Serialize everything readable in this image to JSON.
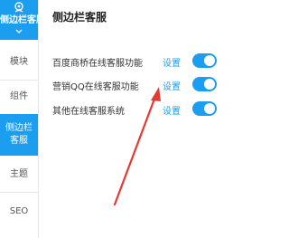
{
  "sidebar": {
    "header_label": "侧边栏客服",
    "items": [
      {
        "label": "模块"
      },
      {
        "label": "组件"
      },
      {
        "label_line1": "侧边栏",
        "label_line2": "客服"
      },
      {
        "label": "主题"
      },
      {
        "label": "SEO"
      }
    ]
  },
  "panel": {
    "title": "侧边栏客服",
    "rows": [
      {
        "label": "百度商桥在线客服功能",
        "link": "设置",
        "enabled": true
      },
      {
        "label": "营销QQ在线客服功能",
        "link": "设置",
        "enabled": true
      },
      {
        "label": "其他在线客服系统",
        "link": "设置",
        "enabled": true
      }
    ]
  },
  "colors": {
    "accent": "#1b9ef0",
    "arrow": "#e53935"
  },
  "icons": {
    "header_icon": "user-headset-icon",
    "header_chevron": "chevron-down-icon"
  }
}
